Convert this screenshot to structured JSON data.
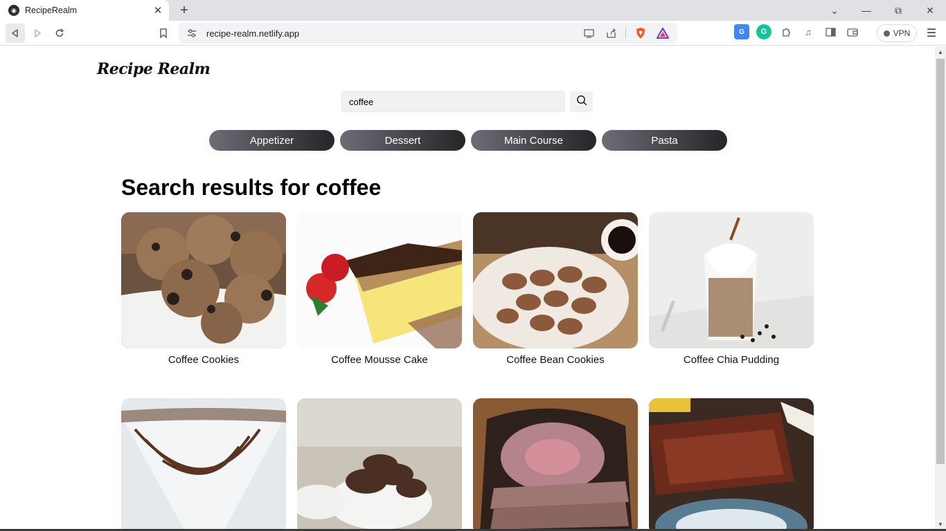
{
  "browser": {
    "tab_title": "RecipeRealm",
    "url": "recipe-realm.netlify.app",
    "vpn_label": "VPN"
  },
  "site": {
    "logo": "Recipe Realm"
  },
  "search": {
    "value": "coffee",
    "placeholder": ""
  },
  "categories": [
    "Appetizer",
    "Dessert",
    "Main Course",
    "Pasta"
  ],
  "results": {
    "title": "Search results for coffee",
    "items": [
      {
        "title": "Coffee Cookies"
      },
      {
        "title": "Coffee Mousse Cake"
      },
      {
        "title": "Coffee Bean Cookies"
      },
      {
        "title": "Coffee Chia Pudding"
      },
      {
        "title": ""
      },
      {
        "title": ""
      },
      {
        "title": ""
      },
      {
        "title": ""
      }
    ]
  }
}
